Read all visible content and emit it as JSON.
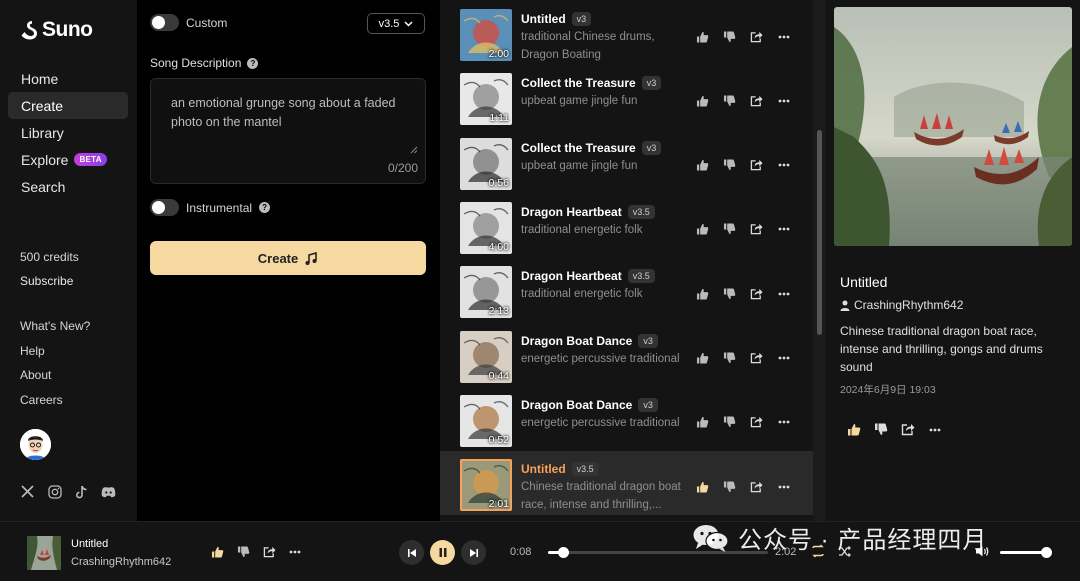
{
  "app": {
    "logo_text": "Suno"
  },
  "sidebar": {
    "nav": [
      {
        "label": "Home"
      },
      {
        "label": "Create",
        "active": true
      },
      {
        "label": "Library"
      },
      {
        "label": "Explore",
        "badge": "BETA"
      },
      {
        "label": "Search"
      }
    ],
    "credits": "500 credits",
    "subscribe": "Subscribe",
    "links": [
      "What's New?",
      "Help",
      "About",
      "Careers"
    ],
    "socials": [
      "x-icon",
      "instagram-icon",
      "tiktok-icon",
      "discord-icon"
    ]
  },
  "create": {
    "custom_label": "Custom",
    "version": "v3.5",
    "description_label": "Song Description",
    "description_value": "an emotional grunge song about a faded photo on the mantel",
    "counter": "0/200",
    "instrumental_label": "Instrumental",
    "create_button": "Create"
  },
  "songs": [
    {
      "title": "Untitled",
      "version": "v3",
      "subtitle": "traditional Chinese drums, Dragon Boating",
      "duration": "2:00"
    },
    {
      "title": "Collect the Treasure",
      "version": "v3",
      "subtitle": "upbeat game jingle fun",
      "duration": "1:11"
    },
    {
      "title": "Collect the Treasure",
      "version": "v3",
      "subtitle": "upbeat game jingle fun",
      "duration": "0:56"
    },
    {
      "title": "Dragon Heartbeat",
      "version": "v3.5",
      "subtitle": "traditional energetic folk",
      "duration": "4:00"
    },
    {
      "title": "Dragon Heartbeat",
      "version": "v3.5",
      "subtitle": "traditional energetic folk",
      "duration": "2:13"
    },
    {
      "title": "Dragon Boat Dance",
      "version": "v3",
      "subtitle": "energetic percussive traditional",
      "duration": "0:44"
    },
    {
      "title": "Dragon Boat Dance",
      "version": "v3",
      "subtitle": "energetic percussive traditional",
      "duration": "0:52"
    },
    {
      "title": "Untitled",
      "version": "v3.5",
      "subtitle": "Chinese traditional dragon boat race, intense and thrilling,...",
      "duration": "2:01",
      "selected": true
    }
  ],
  "detail": {
    "title": "Untitled",
    "author": "CrashingRhythm642",
    "description": "Chinese traditional dragon boat race, intense and thrilling,  gongs and drums sound",
    "date": "2024年6月9日 19:03"
  },
  "player": {
    "title": "Untitled",
    "author": "CrashingRhythm642",
    "current_time": "0:08",
    "total_time": "2:02",
    "progress": 0.066
  },
  "watermark": "公众号 · 产品经理四月",
  "colors": {
    "accent": "#f6d9a1",
    "selected_title": "#f5a25c",
    "beta_gradient": "#c43fd6"
  }
}
